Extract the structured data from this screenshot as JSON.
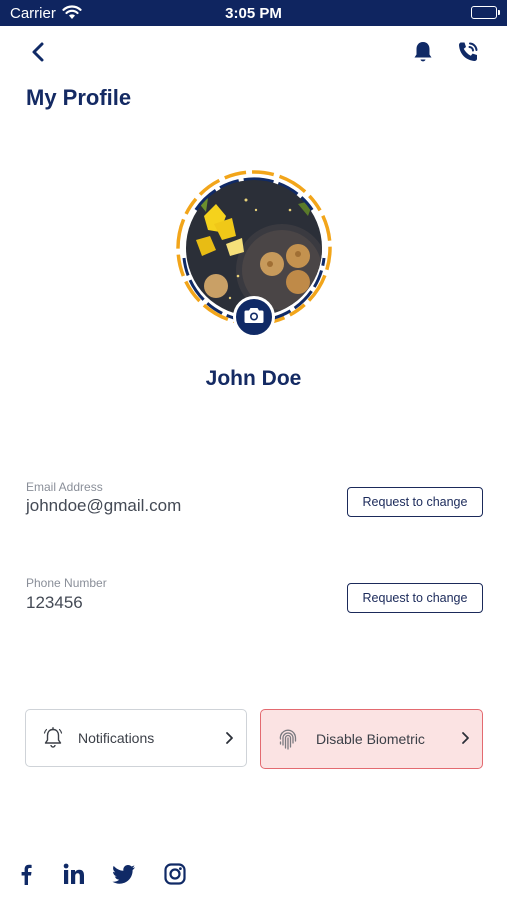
{
  "status_bar": {
    "carrier": "Carrier",
    "time": "3:05 PM"
  },
  "header": {
    "title": "My Profile",
    "icons": [
      "back-chevron-icon",
      "bell-icon",
      "phone-icon"
    ]
  },
  "profile": {
    "name": "John Doe",
    "ring_colors": [
      "#102a66",
      "#f2a51a"
    ]
  },
  "fields": {
    "email": {
      "label": "Email Address",
      "value": "johndoe@gmail.com",
      "button": "Request to change"
    },
    "phone": {
      "label": "Phone Number",
      "value": "123456",
      "button": "Request to change"
    }
  },
  "cards": {
    "notifications": {
      "label": "Notifications"
    },
    "biometric": {
      "label": "Disable Biometric"
    }
  },
  "social": [
    "facebook-icon",
    "linkedin-icon",
    "twitter-icon",
    "instagram-icon"
  ],
  "colors": {
    "primary": "#102a66",
    "accent": "#f2a51a",
    "danger_bg": "#fbe3e3",
    "danger_border": "#e36a70"
  }
}
